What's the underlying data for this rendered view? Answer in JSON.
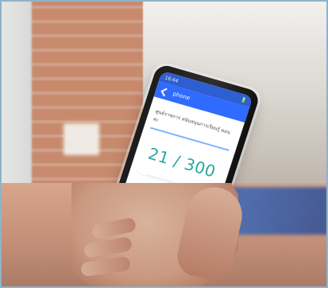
{
  "status_bar": {
    "left": "16:44",
    "right": "🔋"
  },
  "app_bar": {
    "title": "phone"
  },
  "card": {
    "title": "ศูนย์ราชการ สนับสนุนการเรียนรู้ ดอนสะ"
  },
  "counter": {
    "text": "21 / 300"
  },
  "faint": {
    "line1": "",
    "line2": ""
  },
  "bottom": {
    "label": ""
  }
}
